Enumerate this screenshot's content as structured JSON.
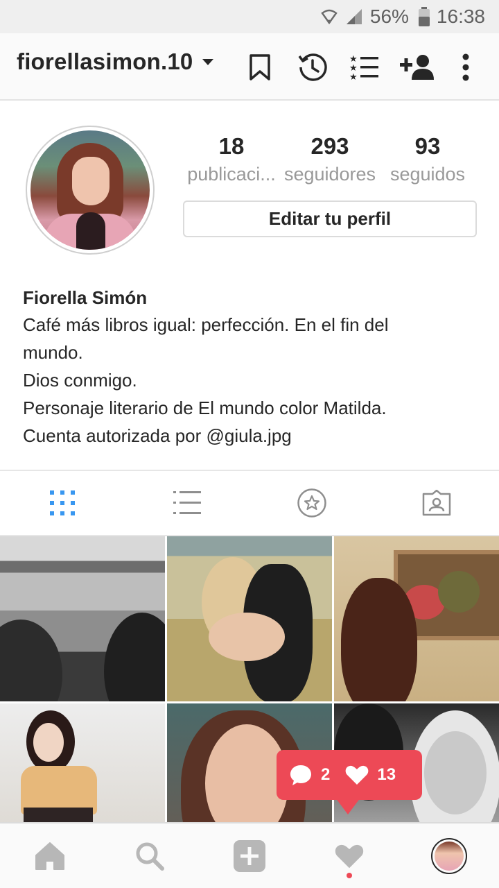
{
  "status_bar": {
    "battery": "56%",
    "time": "16:38"
  },
  "header": {
    "username": "fiorellasimon.10"
  },
  "profile": {
    "stats": [
      {
        "value": "18",
        "label": "publicaci..."
      },
      {
        "value": "293",
        "label": "seguidores"
      },
      {
        "value": "93",
        "label": "seguidos"
      }
    ],
    "edit_button": "Editar tu perfil",
    "name": "Fiorella Simón",
    "bio_lines": [
      "Café más libros igual: perfección. En el fin del",
      "mundo.",
      "Dios conmigo.",
      "Personaje literario de El mundo color Matilda.",
      "Cuenta autorizada por @giula.jpg"
    ]
  },
  "tabs": [
    {
      "icon": "grid-icon",
      "active": true
    },
    {
      "icon": "list-icon",
      "active": false
    },
    {
      "icon": "star-circle-icon",
      "active": false
    },
    {
      "icon": "tagged-person-icon",
      "active": false
    }
  ],
  "notification": {
    "comments": "2",
    "likes": "13",
    "color": "#ed4956"
  },
  "bottom_nav": [
    "home-icon",
    "search-icon",
    "add-post-icon",
    "activity-heart-icon",
    "profile-avatar"
  ],
  "colors": {
    "accent": "#3897f0",
    "notification": "#ed4956",
    "muted": "#999999"
  }
}
